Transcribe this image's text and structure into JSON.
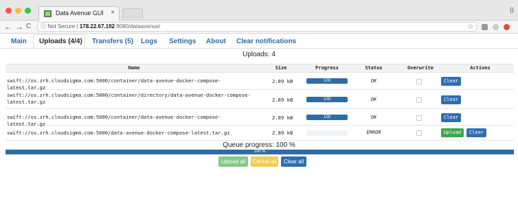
{
  "browser": {
    "tab_title": "Data Avenue GUI",
    "tab_close": "×",
    "url_info_icon": "ⓘ",
    "url_security": "Not Secure",
    "url_host": "178.22.67.192",
    "url_rest": ":8080/dataavenue/",
    "back": "←",
    "forward": "→",
    "reload": "C",
    "star": "☆",
    "profile_icon": "θ"
  },
  "nav": {
    "main": "Main",
    "uploads": "Uploads (4/4)",
    "transfers": "Transfers (5)",
    "logs": "Logs",
    "settings": "Settings",
    "about": "About",
    "clear_notifications": "Clear notifications"
  },
  "uploads_title": "Uploads: 4",
  "table": {
    "headers": [
      "Name",
      "Size",
      "Progress",
      "Status",
      "Overwrite",
      "Actions"
    ],
    "rows": [
      {
        "name": "swift://os.zrh.cloudsigma.com:5000/container/data-avenue-docker-compose-latest.tar.gz",
        "size": "2.89 kB",
        "progress": 100,
        "progress_label": "100",
        "status": "OK",
        "actions": [
          "Clear"
        ]
      },
      {
        "name": "swift://os.zrh.cloudsigma.com:5000/container/directory/data-avenue-docker-compose-latest.tar.gz",
        "size": "2.89 kB",
        "progress": 100,
        "progress_label": "100",
        "status": "OK",
        "actions": [
          "Clear"
        ]
      },
      {
        "name": "swift://os.zrh.cloudsigma.com:5000/container/data-avenue-docker-compose-latest.tar.gz",
        "size": "2.89 kB",
        "progress": 100,
        "progress_label": "100",
        "status": "OK",
        "actions": [
          "Clear"
        ]
      },
      {
        "name": "swift://os.zrh.cloudsigma.com:5000/data-avenue-docker-compose-latest.tar.gz",
        "size": "2.89 kB",
        "progress": 0,
        "progress_label": "",
        "status": "ERROR",
        "actions": [
          "Upload",
          "Clear"
        ]
      }
    ]
  },
  "queue": {
    "label": "Queue progress: 100 %",
    "progress": 100,
    "bar_label": "100 %"
  },
  "buttons": {
    "upload_all": "Upload all",
    "cancel_all": "Cancel all",
    "clear_all": "Clear all"
  },
  "colors": {
    "primary": "#2f6db2",
    "success": "#5cb85c",
    "warning": "#f0c232",
    "link": "#2d6aa8"
  }
}
